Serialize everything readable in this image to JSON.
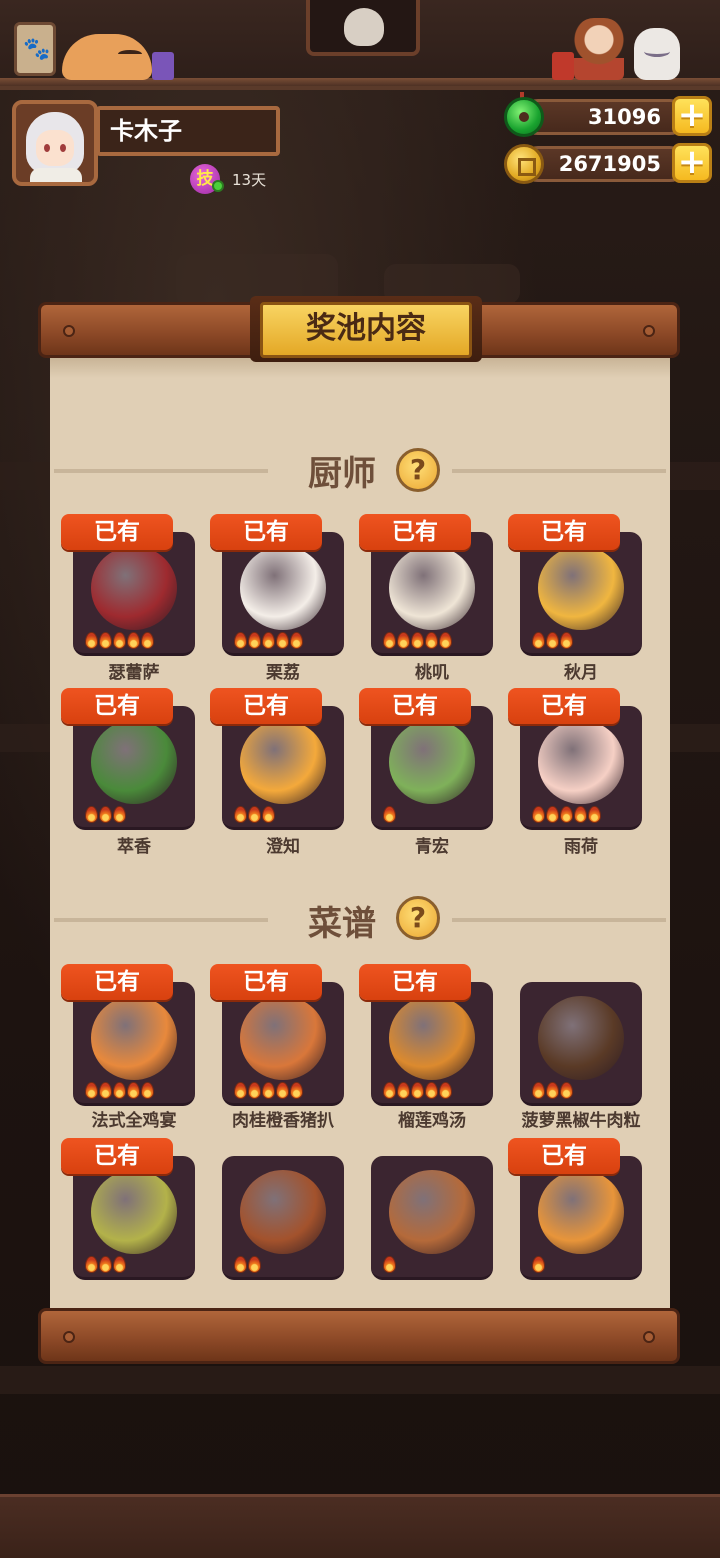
{
  "player": {
    "name": "卡木子",
    "skill_label": "技",
    "skill_days": "13天"
  },
  "currency": {
    "jade": "31096",
    "coins": "2671905",
    "plus_label": "+"
  },
  "panel": {
    "title": "奖池内容",
    "owned_label": "已有",
    "help_label": "?"
  },
  "sections": {
    "chefs": {
      "title": "厨师",
      "items": [
        {
          "name": "瑟蕾萨",
          "owned": true,
          "flames": 5,
          "color": "#9e2a2f"
        },
        {
          "name": "栗荔",
          "owned": true,
          "flames": 5,
          "color": "#f4eee8"
        },
        {
          "name": "桃叽",
          "owned": true,
          "flames": 5,
          "color": "#efe5d6"
        },
        {
          "name": "秋月",
          "owned": true,
          "flames": 3,
          "color": "#f0b640"
        },
        {
          "name": "萃香",
          "owned": true,
          "flames": 3,
          "color": "#4a8a3a"
        },
        {
          "name": "澄知",
          "owned": true,
          "flames": 3,
          "color": "#f4a93b"
        },
        {
          "name": "青宏",
          "owned": true,
          "flames": 1,
          "color": "#7fb15a"
        },
        {
          "name": "雨荷",
          "owned": true,
          "flames": 5,
          "color": "#f6d0c5"
        }
      ]
    },
    "recipes": {
      "title": "菜谱",
      "items": [
        {
          "name": "法式全鸡宴",
          "owned": true,
          "flames": 5,
          "color": "#e8893c"
        },
        {
          "name": "肉桂橙香猪扒",
          "owned": true,
          "flames": 5,
          "color": "#d9773a"
        },
        {
          "name": "榴莲鸡汤",
          "owned": true,
          "flames": 5,
          "color": "#dc8a2e"
        },
        {
          "name": "菠萝黑椒牛肉粒",
          "owned": false,
          "flames": 3,
          "color": "#5a3a26"
        },
        {
          "name": "",
          "owned": true,
          "flames": 3,
          "color": "#b3b24a"
        },
        {
          "name": "",
          "owned": false,
          "flames": 2,
          "color": "#a3522c"
        },
        {
          "name": "",
          "owned": false,
          "flames": 1,
          "color": "#b56a3a"
        },
        {
          "name": "",
          "owned": true,
          "flames": 1,
          "color": "#e8953a"
        }
      ]
    }
  }
}
